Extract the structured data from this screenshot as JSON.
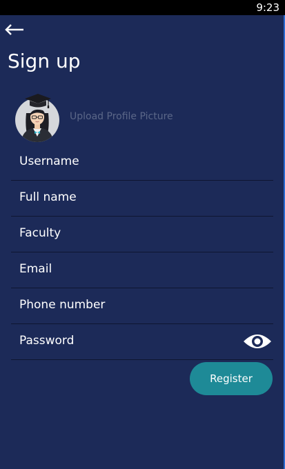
{
  "status_bar": {
    "time": "9:23"
  },
  "header": {
    "back_icon": "arrow-left-icon",
    "title": "Sign up"
  },
  "profile": {
    "avatar_icon": "graduate-avatar",
    "upload_label": "Upload Profile Picture"
  },
  "form": {
    "fields": [
      {
        "label": "Username"
      },
      {
        "label": "Full name"
      },
      {
        "label": "Faculty"
      },
      {
        "label": "Email"
      },
      {
        "label": "Phone number"
      },
      {
        "label": "Password",
        "trailing_icon": "eye-icon"
      }
    ],
    "register_label": "Register"
  },
  "colors": {
    "background": "#1c2a58",
    "status_bar": "#000000",
    "divider": "#0e1530",
    "button": "#1e8a97",
    "placeholder": "#5b6788",
    "text": "#ffffff"
  }
}
